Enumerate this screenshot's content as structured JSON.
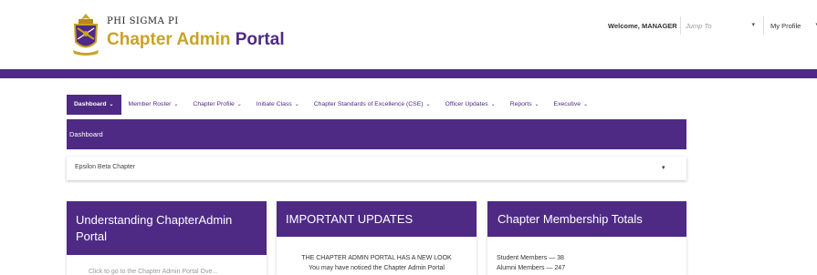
{
  "brand": {
    "org": "PHI SIGMA PI",
    "title_part1": "Chapter Admin",
    "title_part2": "Portal"
  },
  "topbar": {
    "welcome": "Welcome, MANAGER",
    "jump_placeholder": "Jump To",
    "profile_label": "My Profile"
  },
  "nav": {
    "items": [
      {
        "label": "Dashboard",
        "active": true
      },
      {
        "label": "Member Roster"
      },
      {
        "label": "Chapter Profile"
      },
      {
        "label": "Initiate Class"
      },
      {
        "label": "Chapter Standards of Excellence (CSE)"
      },
      {
        "label": "Officer Updates"
      },
      {
        "label": "Reports"
      },
      {
        "label": "Executive"
      }
    ]
  },
  "page": {
    "title": "Dashboard",
    "chapter_selected": "Epsilon Beta Chapter"
  },
  "cards": {
    "understanding": {
      "title": "Understanding ChapterAdmin Portal",
      "body": "Click to go to the Chapter Admin Portal Ove..."
    },
    "updates": {
      "title": "IMPORTANT UPDATES",
      "line1": "THE CHAPTER ADMIN PORTAL HAS A NEW LOOK",
      "line2": "You may have noticed the Chapter Admin Portal"
    },
    "membership": {
      "title": "Chapter Membership Totals",
      "student": "Student Members — 38",
      "alumni": "Alumni Members — 247"
    }
  },
  "colors": {
    "primary": "#4e2a84",
    "gold": "#c9a227"
  },
  "icons": {
    "crest": "phi-sigma-pi-crest",
    "dropdown": "chevron-down-icon"
  }
}
